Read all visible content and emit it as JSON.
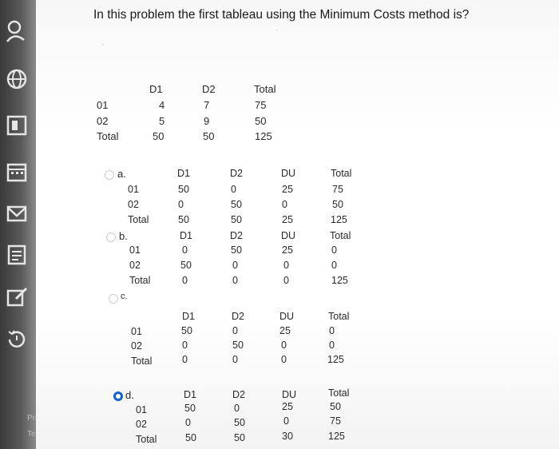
{
  "question": "In this problem the first tableau using the Minimum Costs method is?",
  "sidebar": {
    "text1": "Priv",
    "text2": "Terr"
  },
  "problem": {
    "headers": [
      "D1",
      "D2",
      "Total"
    ],
    "rows": [
      {
        "label": "01",
        "values": [
          "4",
          "7",
          "75"
        ]
      },
      {
        "label": "02",
        "values": [
          "5",
          "9",
          "50"
        ]
      },
      {
        "label": "Total",
        "values": [
          "50",
          "50",
          "125"
        ]
      }
    ]
  },
  "options": [
    {
      "letter": "a.",
      "selected": false,
      "headers": [
        "D1",
        "D2",
        "DU",
        "Total"
      ],
      "rows": [
        {
          "label": "01",
          "values": [
            "50",
            "0",
            "25",
            "75"
          ]
        },
        {
          "label": "02",
          "values": [
            "0",
            "50",
            "0",
            "50"
          ]
        },
        {
          "label": "Total",
          "values": [
            "50",
            "50",
            "25",
            "125"
          ]
        }
      ]
    },
    {
      "letter": "b.",
      "selected": false,
      "headers": [
        "D1",
        "D2",
        "DU",
        "Total"
      ],
      "rows": [
        {
          "label": "01",
          "values": [
            "0",
            "50",
            "25",
            "0"
          ]
        },
        {
          "label": "02",
          "values": [
            "50",
            "0",
            "0",
            "0"
          ]
        },
        {
          "label": "Total",
          "values": [
            "0",
            "0",
            "0",
            "125"
          ]
        }
      ]
    },
    {
      "letter": "c.",
      "selected": false,
      "headers": [
        "D1",
        "D2",
        "DU",
        "Total"
      ],
      "rows": [
        {
          "label": "01",
          "values": [
            "50",
            "0",
            "25",
            "0"
          ]
        },
        {
          "label": "02",
          "values": [
            "0",
            "50",
            "0",
            "0"
          ]
        },
        {
          "label": "Total",
          "values": [
            "0",
            "0",
            "0",
            "125"
          ]
        }
      ]
    },
    {
      "letter": "d.",
      "selected": true,
      "headers": [
        "D1",
        "D2",
        "DU",
        "Total"
      ],
      "rows": [
        {
          "label": "01",
          "values": [
            "50",
            "0",
            "25",
            "50"
          ]
        },
        {
          "label": "02",
          "values": [
            "0",
            "50",
            "0",
            "75"
          ]
        },
        {
          "label": "Total",
          "values": [
            "50",
            "50",
            "30",
            "125"
          ]
        }
      ]
    }
  ]
}
